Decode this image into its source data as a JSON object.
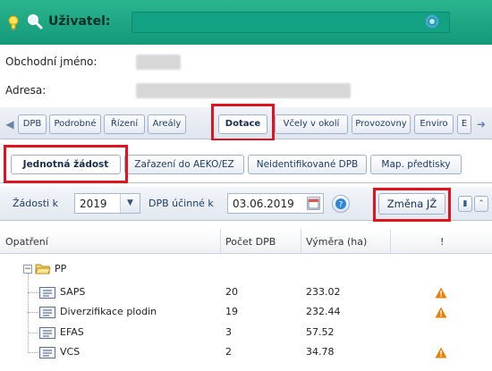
{
  "header": {
    "label": "Uživatel:",
    "icons": [
      "lightbulb-icon",
      "search-icon",
      "refresh-icon"
    ]
  },
  "info": {
    "business_name_label": "Obchodní jméno:",
    "address_label": "Adresa:"
  },
  "tabs_main": [
    {
      "label": "DPB"
    },
    {
      "label": "Podrobné"
    },
    {
      "label": "Řízení"
    },
    {
      "label": "Areály"
    },
    {
      "label": "Dotace",
      "active": true
    },
    {
      "label": "Včely v okolí"
    },
    {
      "label": "Provozovny"
    },
    {
      "label": "Enviro"
    },
    {
      "label": "E"
    }
  ],
  "tabs_sub": [
    {
      "label": "Jednotná žádost",
      "active": true
    },
    {
      "label": "Zařazení do AEKO/EZ"
    },
    {
      "label": "Neidentifikované DPB"
    },
    {
      "label": "Map. předtisky"
    }
  ],
  "toolbar": {
    "requests_label": "Žádosti k",
    "year_value": "2019",
    "dpb_label": "DPB účinné k",
    "date_value": "03.06.2019",
    "change_button": "Změna JŽ"
  },
  "grid": {
    "columns": [
      "Opatření",
      "Počet DPB",
      "Výměra (ha)",
      "!"
    ],
    "group": "PP",
    "rows": [
      {
        "name": "SAPS",
        "count": "20",
        "area": "233.02",
        "warning": true
      },
      {
        "name": "Diverzifikace plodin",
        "count": "19",
        "area": "232.44",
        "warning": true
      },
      {
        "name": "EFAS",
        "count": "3",
        "area": "57.52",
        "warning": false
      },
      {
        "name": "VCS",
        "count": "2",
        "area": "34.78",
        "warning": true
      }
    ]
  },
  "colors": {
    "header_green": "#1aa784",
    "highlight_red": "#e0141e",
    "warning_orange": "#e8800c"
  }
}
